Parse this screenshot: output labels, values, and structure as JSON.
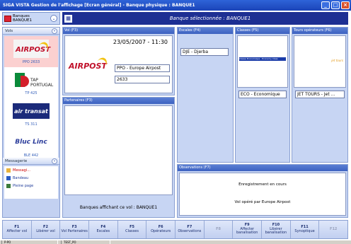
{
  "window": {
    "title": "SIGA VISTA Gestion de l'affichage [Ecran général] - Banque physique : BANQUE1"
  },
  "selector": {
    "line1": "Banques",
    "line2": "BANQUE1"
  },
  "header": {
    "title": "Banque sélectionnée : BANQUE1"
  },
  "sidebar": {
    "vols_title": "Vols",
    "flights": [
      {
        "logo_text": "AIRPOST",
        "code": "PPO 2633"
      },
      {
        "logo_text": "TAP PORTUGAL",
        "code": "TP 425"
      },
      {
        "logo_text": "air transat",
        "code": "TS 311"
      },
      {
        "logo_text": "Bluc Linc",
        "code": "BLE 442"
      }
    ],
    "messagerie_title": "Messagerie",
    "messages": [
      {
        "label": "Messagi..."
      },
      {
        "label": "Bandeau"
      },
      {
        "label": "Pleine page"
      }
    ]
  },
  "vol_panel": {
    "title": "Vol (F3)",
    "datetime": "23/05/2007 - 11:30",
    "logo_text": "AIRPOST",
    "company": "PPO - Europe Airpost",
    "number": "2633"
  },
  "escales_panel": {
    "title": "Escales (F4)",
    "value": "DJE - Djerba"
  },
  "classes_panel": {
    "title": "Classes (F5)",
    "banner": "Classe Economique  ·  Economy Class",
    "value": "ECO - Economique"
  },
  "tours_panel": {
    "title": "Tours opérateurs (F6)",
    "banner": "jet tours",
    "value": "JET TOURS - Jet ..."
  },
  "partenaires_panel": {
    "title": "Partenaires (F3)",
    "footer": "Banques affichant ce vol : BANQUE1"
  },
  "observations_panel": {
    "title": "Observations (F7)",
    "line1": "Enregistrement en cours",
    "line2": "Vol opéré par Europe Airpost"
  },
  "function_keys": [
    {
      "key": "F1",
      "label": "Affecter vol",
      "enabled": true
    },
    {
      "key": "F2",
      "label": "Libérer vol",
      "enabled": true
    },
    {
      "key": "F3",
      "label": "Vol Partenaires",
      "enabled": true
    },
    {
      "key": "F4",
      "label": "Escales",
      "enabled": true
    },
    {
      "key": "F5",
      "label": "Classes",
      "enabled": true
    },
    {
      "key": "F6",
      "label": "Opérateurs",
      "enabled": true
    },
    {
      "key": "F7",
      "label": "Observations",
      "enabled": true
    },
    {
      "key": "F8",
      "label": "",
      "enabled": false
    },
    {
      "key": "F9",
      "label": "Affecter banalisation",
      "enabled": true
    },
    {
      "key": "F10",
      "label": "Libérer banalisation",
      "enabled": true
    },
    {
      "key": "F11",
      "label": "Synoptique",
      "enabled": true
    },
    {
      "key": "F12",
      "label": "",
      "enabled": false
    }
  ],
  "status": {
    "cell1": "P-PO",
    "cell2": "TEST_PO"
  },
  "colors": {
    "header_bg": "#1d2f93",
    "panel_bg": "#c7d5f3",
    "active_flight": "#fbd0d0"
  }
}
